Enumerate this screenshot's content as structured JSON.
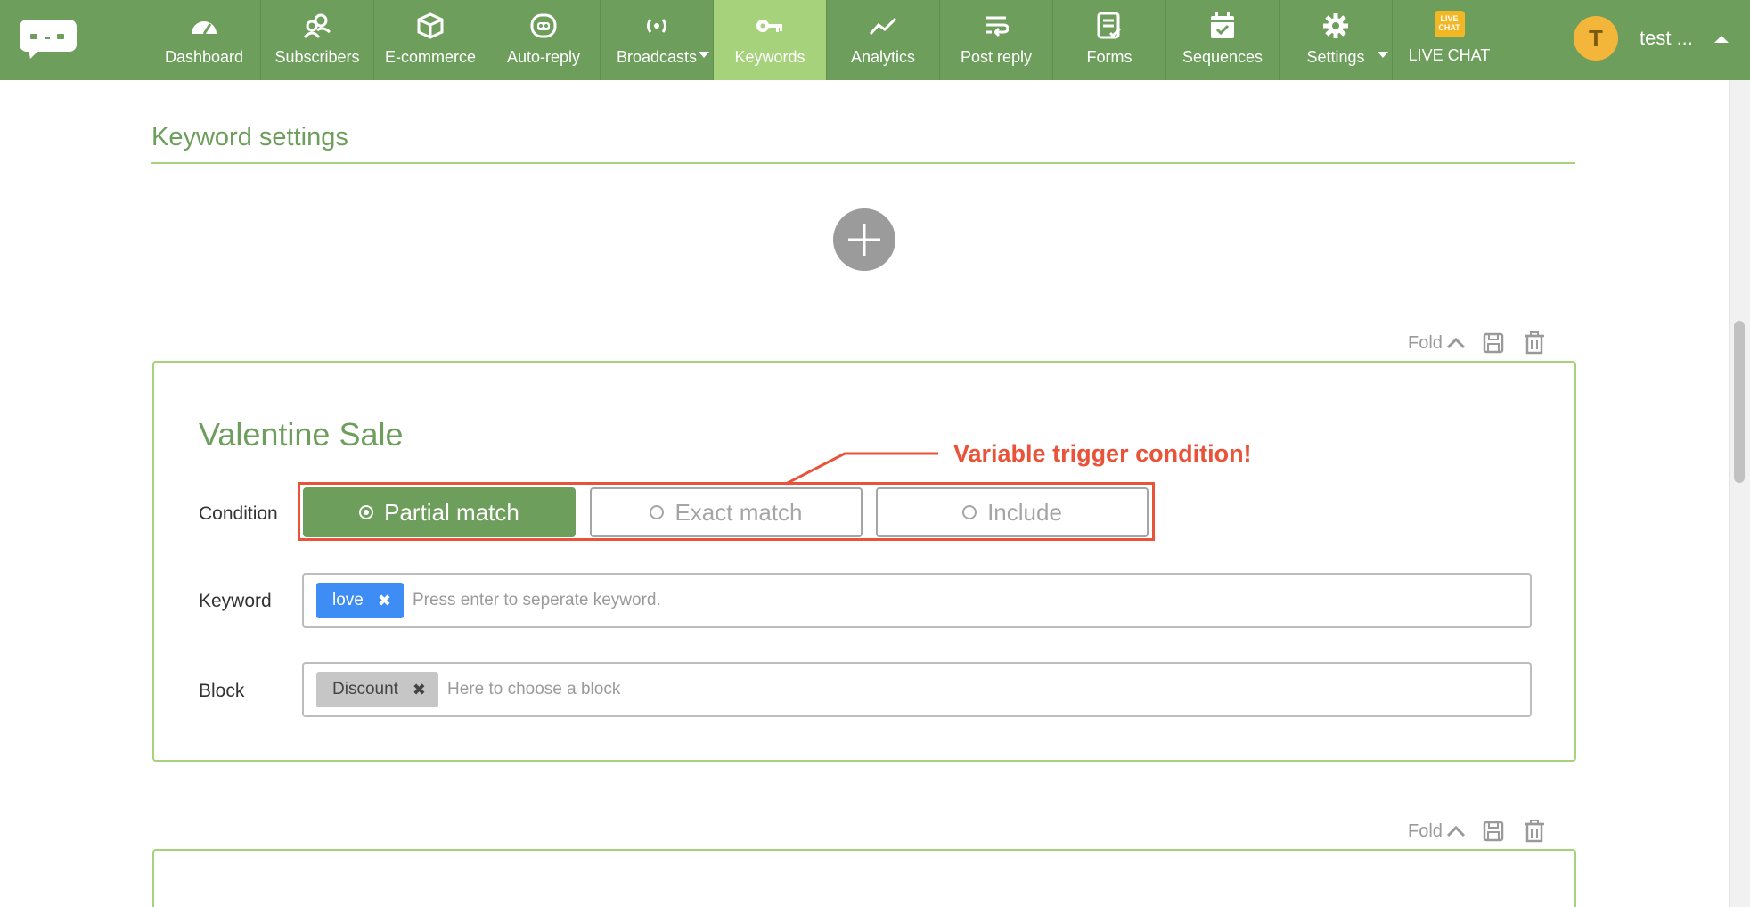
{
  "nav": {
    "items": [
      {
        "label": "Dashboard",
        "icon": "dashboard-gauge-icon"
      },
      {
        "label": "Subscribers",
        "icon": "users-icon"
      },
      {
        "label": "E-commerce",
        "icon": "box-icon"
      },
      {
        "label": "Auto-reply",
        "icon": "robot-icon"
      },
      {
        "label": "Broadcasts",
        "icon": "broadcast-icon"
      },
      {
        "label": "Keywords",
        "icon": "key-icon",
        "active": true
      },
      {
        "label": "Analytics",
        "icon": "trend-line-icon"
      },
      {
        "label": "Post reply",
        "icon": "reply-lines-icon"
      },
      {
        "label": "Forms",
        "icon": "form-check-icon"
      },
      {
        "label": "Sequences",
        "icon": "calendar-check-icon"
      },
      {
        "label": "Settings",
        "icon": "gear-icon"
      },
      {
        "label": "LIVE CHAT",
        "icon": "live-chat-badge-icon"
      }
    ],
    "live_badge_line1": "LIVE",
    "live_badge_line2": "CHAT",
    "user_initial": "T",
    "user_name": "test ..."
  },
  "section": {
    "title": "Keyword settings"
  },
  "card1": {
    "fold_label": "Fold",
    "title": "Valentine Sale",
    "condition_label": "Condition",
    "conditions": [
      {
        "label": "Partial match",
        "selected": true
      },
      {
        "label": "Exact match",
        "selected": false
      },
      {
        "label": "Include",
        "selected": false
      }
    ],
    "callout": "Variable trigger condition!",
    "keyword_label": "Keyword",
    "keyword_chip": "love",
    "keyword_placeholder": "Press enter to seperate keyword.",
    "block_label": "Block",
    "block_chip": "Discount",
    "block_placeholder": "Here to choose a block"
  },
  "card2": {
    "fold_label": "Fold"
  },
  "colors": {
    "nav_green": "#6d9e5c",
    "active_green": "#a7d27c",
    "callout_red": "#e8533a",
    "chip_blue": "#3d8df5"
  }
}
